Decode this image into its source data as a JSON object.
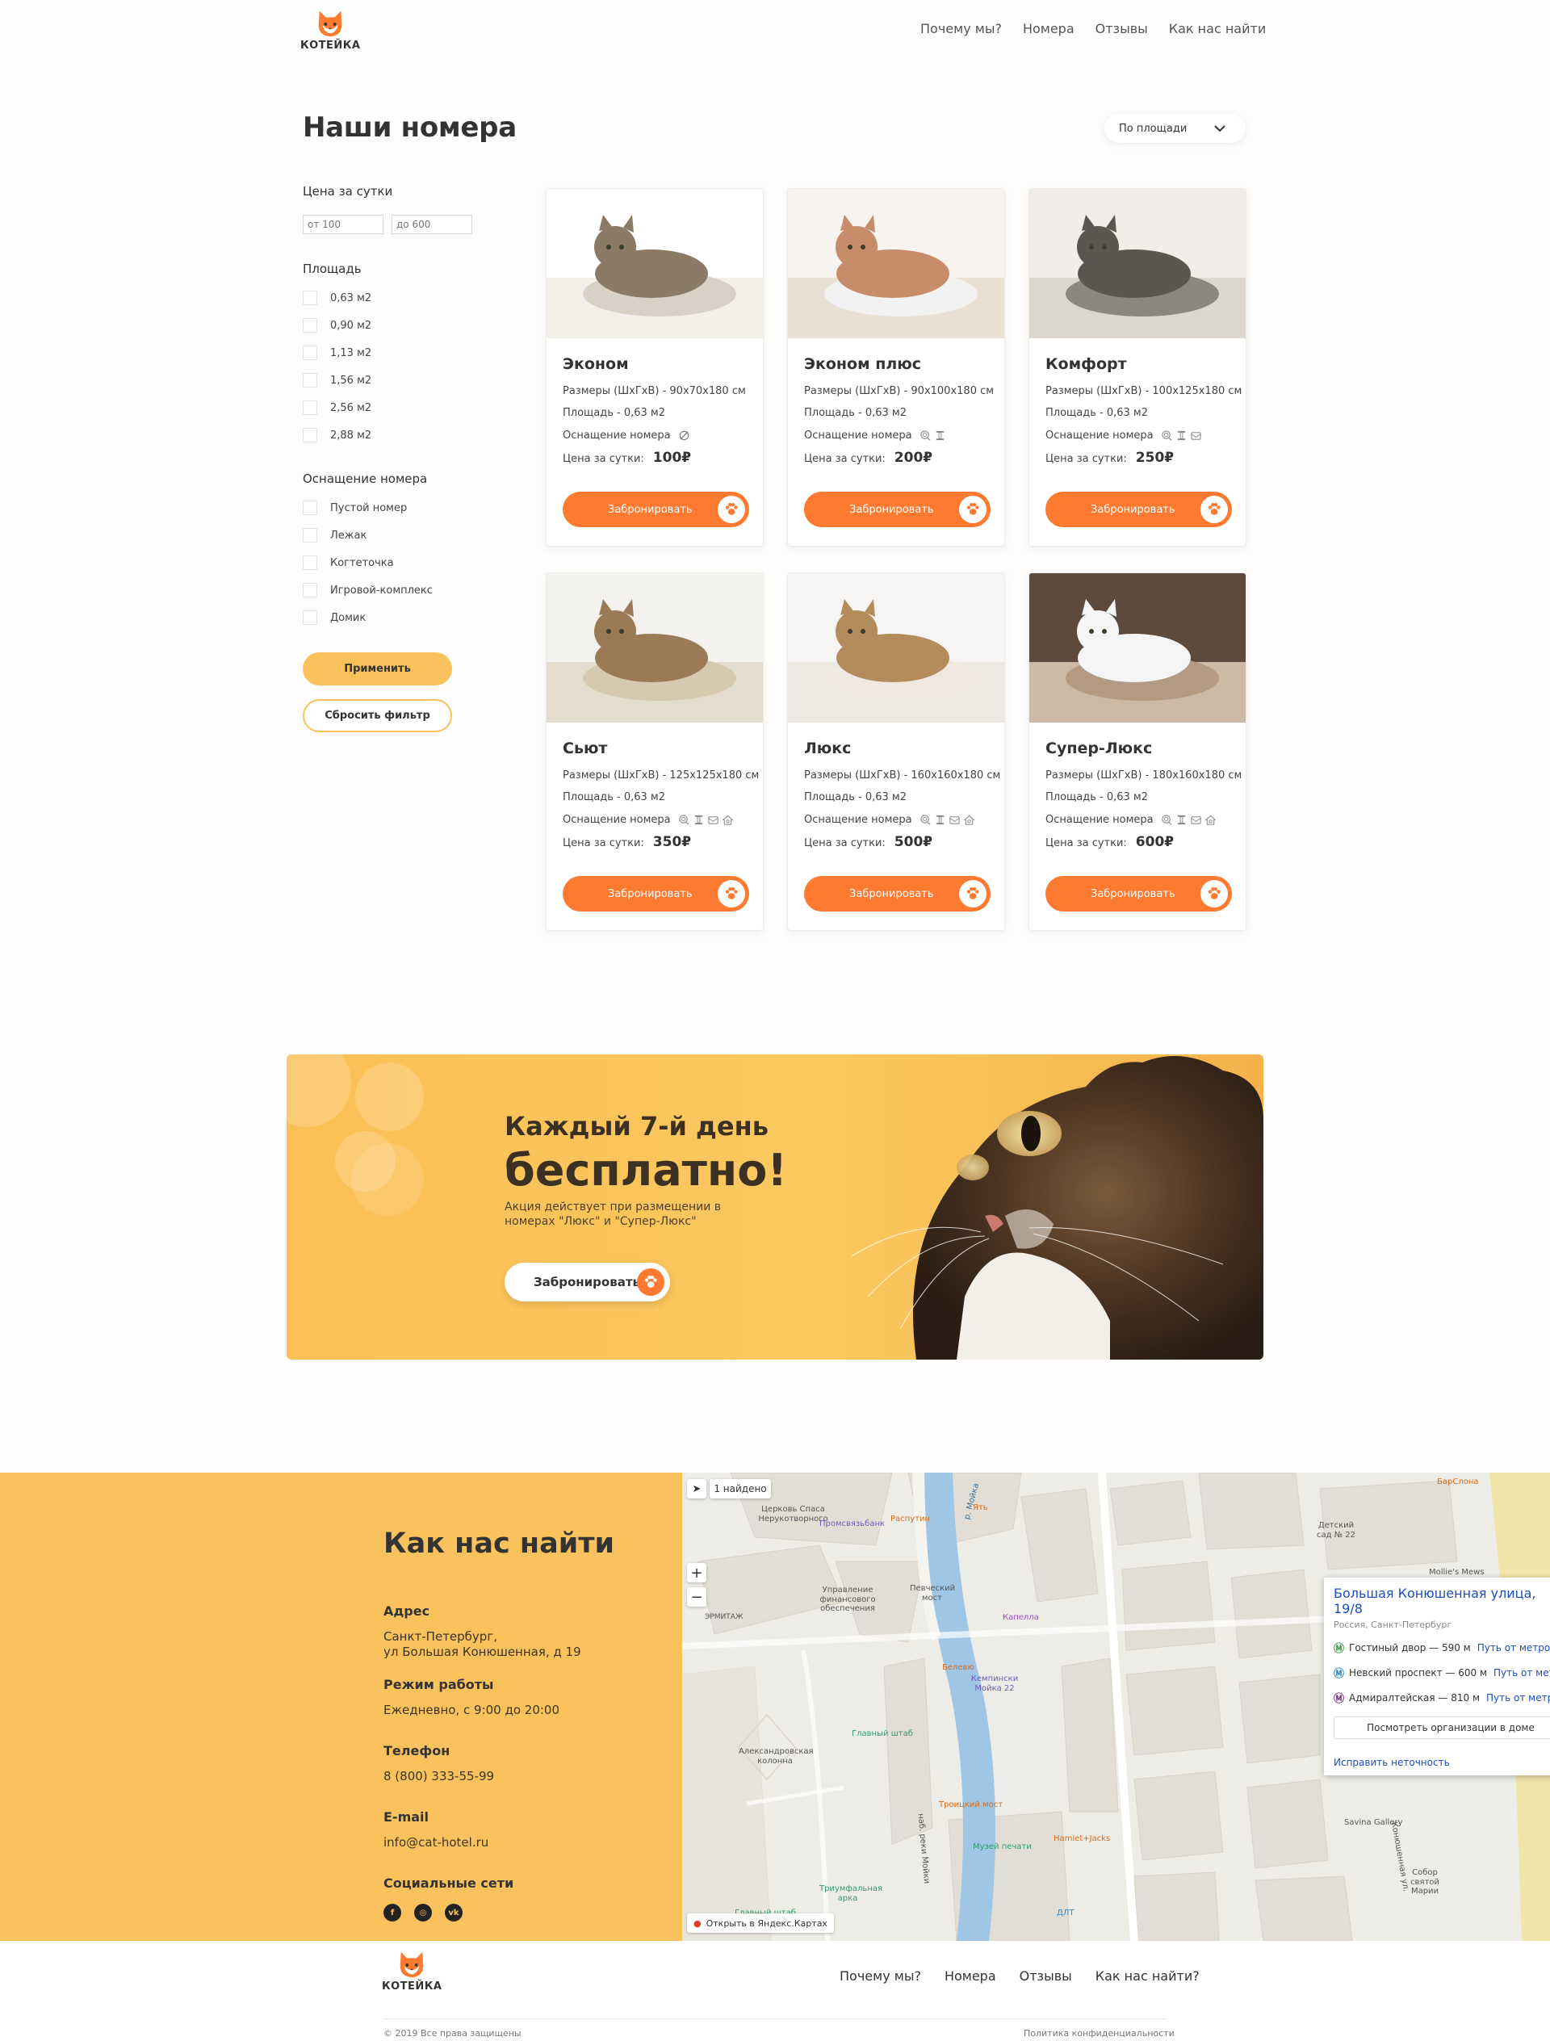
{
  "brand": {
    "name": "КОТЕЙКА",
    "accent": "#fd7a30",
    "yellow": "#f9c25c"
  },
  "nav": [
    "Почему мы?",
    "Номера",
    "Отзывы",
    "Как нас найти"
  ],
  "rooms_section": {
    "title": "Наши номера",
    "sort_value": "По площади"
  },
  "filters": {
    "price_title": "Цена за сутки",
    "price_from_placeholder": "от 100",
    "price_to_placeholder": "до 600",
    "area_title": "Площадь",
    "areas": [
      "0,63 м2",
      "0,90 м2",
      "1,13 м2",
      "1,56 м2",
      "2,56 м2",
      "2,88 м2"
    ],
    "equipment_title": "Оснащение номера",
    "equipment": [
      "Пустой номер",
      "Лежак",
      "Когтеточка",
      "Игровой-комплекс",
      "Домик"
    ],
    "apply_label": "Применить",
    "reset_label": "Сбросить фильтр"
  },
  "card_labels": {
    "equipment": "Оснащение номера",
    "price": "Цена за сутки:",
    "book": "Забронировать"
  },
  "rooms": [
    {
      "name": "Эконом",
      "size": "Размеры (ШхГхВ) - 90х70х180 см",
      "area": "Площадь - 0,63 м2",
      "price": "100₽",
      "icons": [
        "empty-icon"
      ]
    },
    {
      "name": "Эконом плюс",
      "size": "Размеры (ШхГхВ) - 90х100х180 см",
      "area": "Площадь - 0,63 м2",
      "price": "200₽",
      "icons": [
        "bed-icon",
        "scratcher-icon"
      ]
    },
    {
      "name": "Комфорт",
      "size": "Размеры (ШхГхВ) - 100х125х180 см",
      "area": "Площадь - 0,63 м2",
      "price": "250₽",
      "icons": [
        "bed-icon",
        "scratcher-icon",
        "play-complex-icon"
      ]
    },
    {
      "name": "Сьют",
      "size": "Размеры (ШхГхВ) - 125х125х180 см",
      "area": "Площадь - 0,63 м2",
      "price": "350₽",
      "icons": [
        "bed-icon",
        "scratcher-icon",
        "play-complex-icon",
        "house-icon"
      ]
    },
    {
      "name": "Люкс",
      "size": "Размеры (ШхГхВ) - 160х160х180 см",
      "area": "Площадь - 0,63 м2",
      "price": "500₽",
      "icons": [
        "bed-icon",
        "scratcher-icon",
        "play-complex-icon",
        "house-icon"
      ]
    },
    {
      "name": "Супер-Люкс",
      "size": "Размеры (ШхГхВ) - 180х160х180 см",
      "area": "Площадь - 0,63 м2",
      "price": "600₽",
      "icons": [
        "bed-icon",
        "scratcher-icon",
        "play-complex-icon",
        "house-icon"
      ]
    }
  ],
  "promo": {
    "line1": "Каждый 7-й день",
    "line2": "бесплатно!",
    "sub": "Акция действует при размещении в номерах \"Люкс\" и \"Супер-Люкс\"",
    "button": "Забронировать"
  },
  "contacts": {
    "title": "Как нас найти",
    "address_label": "Адрес",
    "address_line1": "Санкт-Петербург,",
    "address_line2": "ул Большая Конюшенная, д 19",
    "hours_label": "Режим работы",
    "hours": "Ежедневно, с 9:00 до 20:00",
    "phone_label": "Телефон",
    "phone": "8 (800) 333-55-99",
    "email_label": "E-mail",
    "email": "info@cat-hotel.ru",
    "social_label": "Социальные сети",
    "social": [
      "facebook-icon",
      "instagram-icon",
      "vk-icon"
    ]
  },
  "map": {
    "found": "1 найдено",
    "card_title": "Большая Конюшенная улица, 19/8",
    "card_sub": "Россия, Санкт-Петербург",
    "metro": [
      {
        "name": "Гостиный двор — 590 м",
        "color": "#2e9b3f",
        "route": "Путь от метро"
      },
      {
        "name": "Невский проспект — 600 м",
        "color": "#1f8ad3",
        "route": "Путь от метро"
      },
      {
        "name": "Адмиралтейская — 810 м",
        "color": "#7b2b8f",
        "route": "Путь от метро"
      }
    ],
    "orgs_button": "Посмотреть организации в доме",
    "fix_link": "Исправить неточность",
    "open_link": "Открыть в Яндекс.Картах",
    "labels": {
      "church": "Церковь Спаса Нерукотворного",
      "promsvyaz": "Промсвязьбанк",
      "rasputin": "Распутин",
      "yat": "Ять",
      "barslona": "БарСлона",
      "kindergarten": "Детский сад № 22",
      "mollies": "Mollie's Mews",
      "management": "Управление финансового обеспечения",
      "pevchesky": "Певческий мост",
      "kapella": "Капелла",
      "ermitazh": "ЭРМИТАЖ",
      "belevue": "Белевю",
      "kempinski": "Кемпински Мойка 22",
      "glavshtab": "Главный штаб",
      "column": "Александровская колонна",
      "troitsky": "Троицкий мост",
      "museum": "Музей печати",
      "hamlet": "Hamlet+Jacks",
      "savina": "Savina Gallery",
      "arch": "Триумфальная арка",
      "glavshtab2": "Главный штаб",
      "cathedral": "Собор святой Марии",
      "dlt": "ДЛТ",
      "moika": "р. Мойка",
      "nab": "наб. реки Мойки",
      "konyush": "Конюшенная ул."
    }
  },
  "footer": {
    "brand": "КОТЕЙКА",
    "nav": [
      "Почему мы?",
      "Номера",
      "Отзывы",
      "Как нас найти?"
    ],
    "copyright": "© 2019 Все права защищены",
    "policy": "Политика конфиденциальности"
  }
}
